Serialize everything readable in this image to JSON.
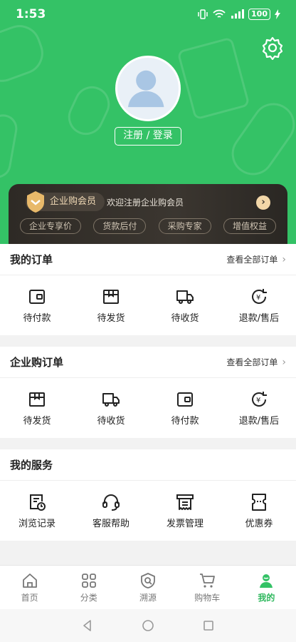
{
  "status": {
    "time": "1:53",
    "battery": "100"
  },
  "profile": {
    "login_label": "注册 / 登录"
  },
  "vip": {
    "badge": "企业购会员",
    "welcome": "欢迎注册企业购会员",
    "perks": [
      "企业专享价",
      "货款后付",
      "采购专家",
      "增值权益"
    ]
  },
  "my_orders": {
    "title": "我的订单",
    "more": "查看全部订单",
    "items": [
      {
        "label": "待付款",
        "icon": "wallet-icon"
      },
      {
        "label": "待发货",
        "icon": "package-icon"
      },
      {
        "label": "待收货",
        "icon": "truck-icon"
      },
      {
        "label": "退款/售后",
        "icon": "refund-icon"
      }
    ]
  },
  "enterprise_orders": {
    "title": "企业购订单",
    "more": "查看全部订单",
    "items": [
      {
        "label": "待发货",
        "icon": "package-icon"
      },
      {
        "label": "待收货",
        "icon": "truck-icon"
      },
      {
        "label": "待付款",
        "icon": "wallet-icon"
      },
      {
        "label": "退款/售后",
        "icon": "refund-icon"
      }
    ]
  },
  "services": {
    "title": "我的服务",
    "items": [
      {
        "label": "浏览记录",
        "icon": "history-icon"
      },
      {
        "label": "客服帮助",
        "icon": "headset-icon"
      },
      {
        "label": "发票管理",
        "icon": "invoice-icon"
      },
      {
        "label": "优惠券",
        "icon": "coupon-icon"
      }
    ]
  },
  "tabbar": {
    "items": [
      {
        "label": "首页",
        "icon": "home-icon"
      },
      {
        "label": "分类",
        "icon": "category-icon"
      },
      {
        "label": "溯源",
        "icon": "trace-icon"
      },
      {
        "label": "购物车",
        "icon": "cart-icon"
      },
      {
        "label": "我的",
        "icon": "profile-icon"
      }
    ],
    "active": "我的"
  },
  "colors": {
    "brand": "#34c266",
    "active_tab": "#2fb85e",
    "vip_gold": "#f2d7a8"
  }
}
